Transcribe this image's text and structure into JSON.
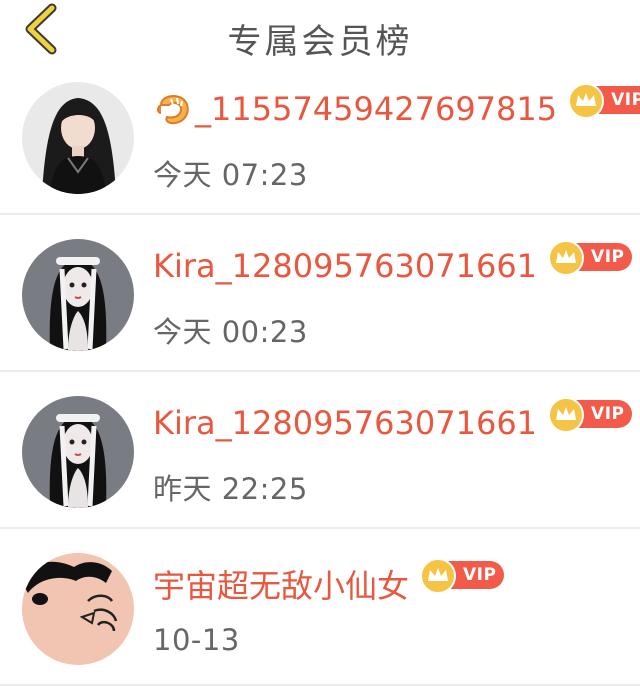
{
  "header": {
    "title": "专属会员榜",
    "back_icon": "chevron-left-icon"
  },
  "colors": {
    "name": "#e9573f",
    "vip_badge": "#f25a4a",
    "crown": "#f5c445",
    "back": "#f2d23c"
  },
  "members": [
    {
      "name": "_1155745942769781 5",
      "display_name": "_11557459427697815",
      "name_prefix_icon": "shrimp-icon",
      "badge": "VIP",
      "time": "今天 07:23"
    },
    {
      "display_name": "Kira_128095763071661",
      "badge": "VIP",
      "time": "今天 00:23"
    },
    {
      "display_name": "Kira_128095763071661",
      "badge": "VIP",
      "time": "昨天 22:25"
    },
    {
      "display_name": "宇宙超无敌小仙女",
      "badge": "VIP",
      "time": "10-13"
    }
  ]
}
